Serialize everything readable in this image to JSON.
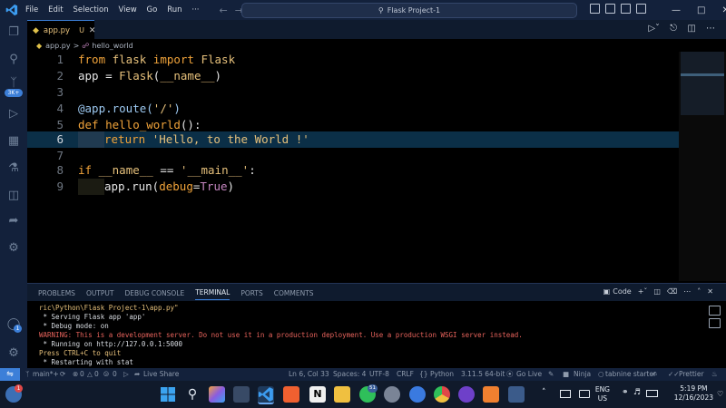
{
  "menu": [
    "File",
    "Edit",
    "Selection",
    "View",
    "Go",
    "Run",
    "···"
  ],
  "search": {
    "label": "Flask Project-1"
  },
  "tab": {
    "file_name": "app.py",
    "status": "U"
  },
  "breadcrumb": {
    "file": "app.py",
    "sep": ">",
    "symbol": "hello_world"
  },
  "code_lines": [
    {
      "num": "1"
    },
    {
      "num": "2"
    },
    {
      "num": "3"
    },
    {
      "num": "4"
    },
    {
      "num": "5"
    },
    {
      "num": "6"
    },
    {
      "num": "7"
    },
    {
      "num": "8"
    },
    {
      "num": "9"
    }
  ],
  "code": {
    "l1": [
      "from",
      " flask ",
      "import",
      " Flask"
    ],
    "l2": [
      "app",
      " = ",
      "Flask",
      "(",
      "__name__",
      ")"
    ],
    "l4": [
      "@app.route(",
      "'/'",
      ")"
    ],
    "l5": [
      "def",
      " ",
      "hello_world",
      "():"
    ],
    "l6": [
      "return",
      " ",
      "'Hello, to the World !'"
    ],
    "l8": [
      "if",
      " ",
      "__name__",
      " == ",
      "'__main__'",
      ":"
    ],
    "l9": [
      "app.run(",
      "debug",
      "=",
      "True",
      ")"
    ]
  },
  "panel_tabs": [
    "PROBLEMS",
    "OUTPUT",
    "DEBUG CONSOLE",
    "TERMINAL",
    "PORTS",
    "COMMENTS"
  ],
  "panel_right": {
    "terminal_type": "Code"
  },
  "terminal": [
    {
      "text": "ric\\Python\\Flask Project-1\\app.py\"",
      "style": "yel"
    },
    {
      "text": " * Serving Flask app 'app'",
      "style": "white"
    },
    {
      "text": " * Debug mode: on",
      "style": "white"
    },
    {
      "text": "WARNING: This is a development server. Do not use it in a production deployment. Use a production WSGI server instead.",
      "style": "warn"
    },
    {
      "text": " * Running on http://127.0.0.1:5000",
      "style": "white"
    },
    {
      "text": "Press CTRL+C to quit",
      "style": "yel"
    },
    {
      "text": " * Restarting with stat",
      "style": "white"
    }
  ],
  "status": {
    "branch": "main*+",
    "errors": "0",
    "warnings": "0",
    "ports": "0",
    "live_share": "Live Share",
    "position": "Ln 6, Col 33",
    "spaces": "Spaces: 4",
    "encoding": "UTF-8",
    "eol": "CRLF",
    "language": "Python",
    "interpreter": "3.11.5 64-bit",
    "go_live": "Go Live",
    "ninja": "Ninja",
    "tabnine": "tabnine starter",
    "prettier": "Prettier"
  },
  "taskbar": {
    "lang_top": "ENG",
    "lang_bottom": "US",
    "time": "5:19 PM",
    "date": "12/16/2023",
    "weather_badge": "1",
    "whatsapp_badge": "51"
  },
  "activity": {
    "remote_badge": "1",
    "extension_badge": "3K+"
  },
  "colors": {
    "accent": "#3c7fd8",
    "keyword": "#f0a33a",
    "string": "#e6c07b",
    "warning": "#e8635c"
  }
}
